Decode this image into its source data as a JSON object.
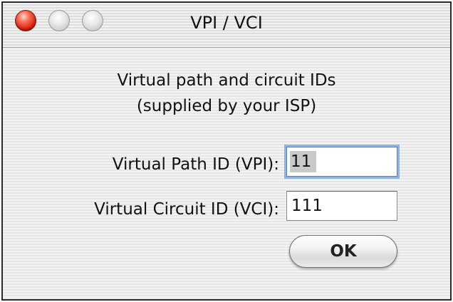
{
  "window": {
    "title": "VPI / VCI"
  },
  "instructions": {
    "line1": "Virtual path and circuit IDs",
    "line2": "(supplied by your ISP)"
  },
  "fields": {
    "vpi_label": "Virtual Path ID (VPI):",
    "vpi_value": "11",
    "vci_label": "Virtual Circuit ID (VCI):",
    "vci_value": "111"
  },
  "buttons": {
    "ok_label": "OK"
  },
  "colors": {
    "close_button": "#d3200f",
    "focus_ring": "#8fb3e3",
    "selection": "#c9c9c9"
  },
  "icons": {
    "close": "close-icon",
    "minimize": "minimize-icon",
    "zoom": "zoom-icon"
  }
}
